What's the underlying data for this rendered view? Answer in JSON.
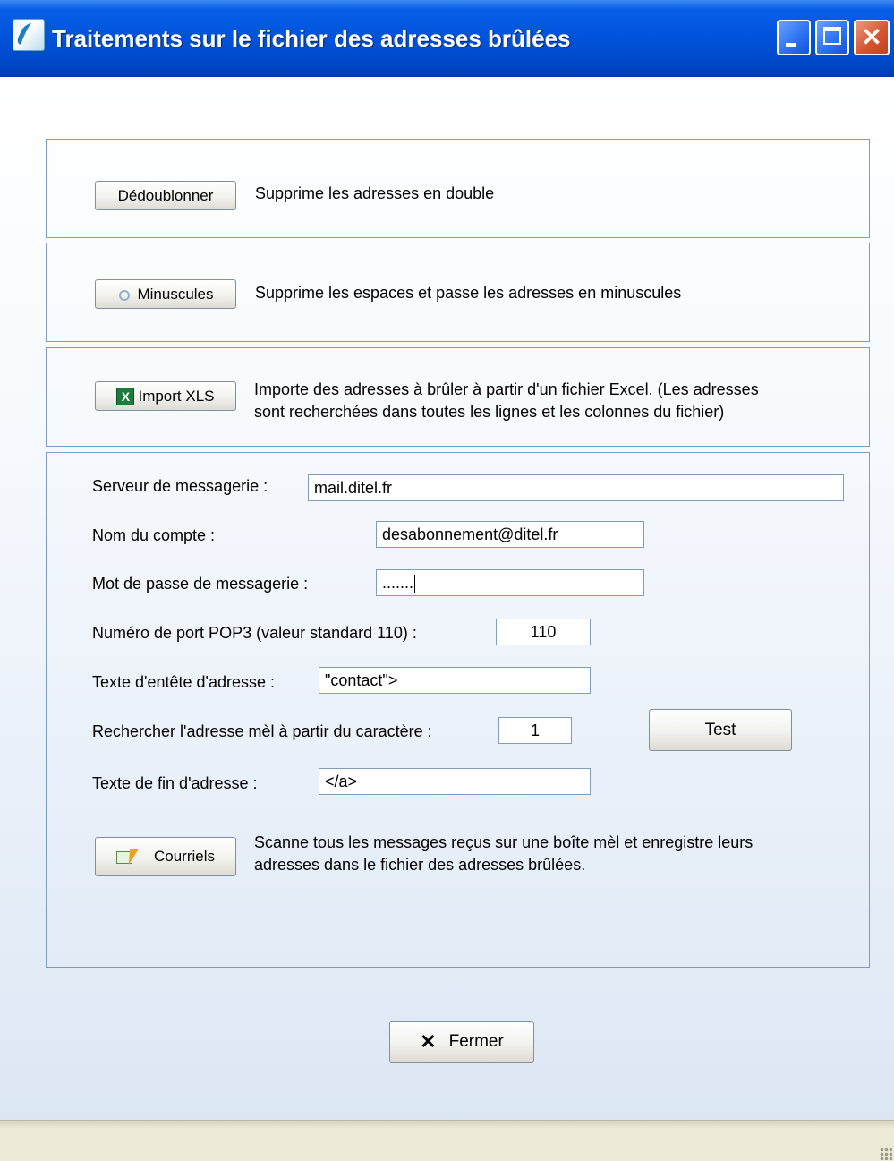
{
  "window": {
    "title": "Traitements sur le fichier des adresses brûlées",
    "controls": {
      "minimize": "minimize",
      "maximize": "maximize",
      "close": "✕"
    }
  },
  "dedoublonner": {
    "button_label": "Dédoublonner",
    "description": "Supprime les adresses en double"
  },
  "minuscules": {
    "button_label": "Minuscules",
    "description": "Supprime les espaces et passe les adresses en minuscules"
  },
  "import_xls": {
    "button_label": "Import XLS",
    "icon": "excel-icon",
    "icon_glyph": "X",
    "description_line1": "Importe des adresses à brûler à partir d'un fichier Excel. (Les adresses",
    "description_line2": "sont recherchées dans toutes les lignes et les colonnes du fichier)"
  },
  "mail_settings": {
    "server_label": "Serveur de messagerie :",
    "server_value": "mail.ditel.fr",
    "account_label": "Nom du compte :",
    "account_value": "desabonnement@ditel.fr",
    "password_label": "Mot de passe de messagerie :",
    "password_value": ".......",
    "port_label": "Numéro de port POP3 (valeur standard 110) :",
    "port_value": "110",
    "header_label": "Texte d'entête d'adresse :",
    "header_value": "\"contact\">",
    "start_char_label": "Rechercher l'adresse mèl à partir du caractère :",
    "start_char_value": "1",
    "test_button": "Test",
    "end_label": "Texte de fin d'adresse :",
    "end_value": "</a>"
  },
  "courriels": {
    "button_label": "Courriels",
    "description_line1": "Scanne tous les messages reçus sur une boîte mèl et enregistre leurs",
    "description_line2": "adresses dans le fichier des adresses brûlées."
  },
  "footer": {
    "close_glyph": "✕",
    "close_label": "Fermer"
  }
}
